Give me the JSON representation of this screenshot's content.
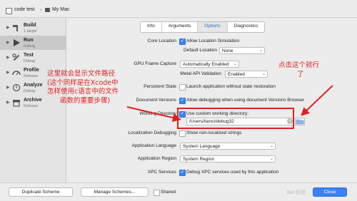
{
  "toolbar": {
    "scheme": "code test",
    "destination": "My Mac"
  },
  "sidebar": {
    "items": [
      {
        "title": "Build",
        "sub": "1 target",
        "selected": false,
        "expanded": true,
        "icon": "hammer-icon"
      },
      {
        "title": "Run",
        "sub": "Debug",
        "selected": true,
        "expanded": true,
        "icon": "play-icon"
      },
      {
        "title": "Test",
        "sub": "Debug",
        "selected": false,
        "expanded": true,
        "icon": "wrench-icon"
      },
      {
        "title": "Profile",
        "sub": "Release",
        "selected": false,
        "expanded": true,
        "icon": "gauge-icon"
      },
      {
        "title": "Analyze",
        "sub": "Debug",
        "selected": false,
        "expanded": true,
        "icon": "analyze-icon"
      },
      {
        "title": "Archive",
        "sub": "Release",
        "selected": false,
        "expanded": true,
        "icon": "archive-icon"
      }
    ]
  },
  "tabs": [
    {
      "label": "Info",
      "active": false
    },
    {
      "label": "Arguments",
      "active": false
    },
    {
      "label": "Options",
      "active": true
    },
    {
      "label": "Diagnostics",
      "active": false
    }
  ],
  "options": {
    "core_location_label": "Core Location",
    "allow_location_sim": "Allow Location Simulation",
    "default_location_label": "Default Location",
    "default_location_value": "None",
    "gpu_capture_label": "GPU Frame Capture",
    "gpu_capture_value": "Automatically Enabled",
    "metal_api_label": "Metal API Validation",
    "metal_api_value": "Enabled",
    "persistent_state_label": "Persistent State",
    "launch_without_restore": "Launch application without state restoration",
    "document_versions_label": "Document Versions",
    "allow_debugging_versions": "Allow debugging when using document Versions Browser",
    "working_dir_label": "Working Directory",
    "use_custom_working_dir": "Use custom working directory:",
    "working_dir_path": "/Users/tianci/debug32",
    "localization_debugging_label": "Localization Debugging",
    "show_nonlocalized": "Show non-localized strings",
    "app_language_label": "Application Language",
    "app_language_value": "System Language",
    "app_region_label": "Application Region",
    "app_region_value": "System Region",
    "xpc_label": "XPC Services",
    "xpc_debug": "Debug XPC services used by this application"
  },
  "annotations": {
    "left_lines": [
      "这里就会显示文件路径",
      "(这个同样是在Xcode中",
      "怎样使用c语言中的文件",
      "函数的重要步骤)"
    ],
    "right_lines": [
      "点击这个就行",
      "了"
    ],
    "color": "#e02020"
  },
  "footer": {
    "duplicate": "Duplicate Scheme",
    "manage": "Manage Schemes...",
    "shared": "Shared",
    "close": "Close",
    "watermark": "Bai 经验"
  }
}
